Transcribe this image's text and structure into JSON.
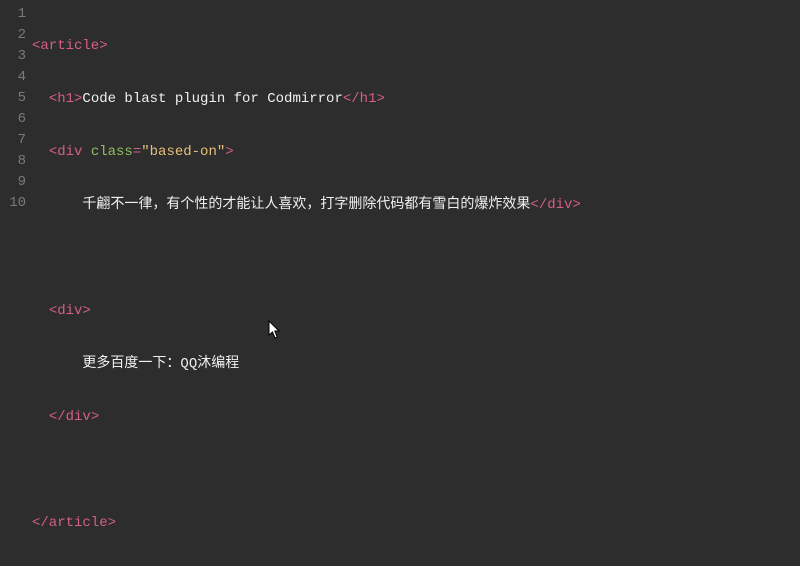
{
  "editor": {
    "gutter": [
      "1",
      "2",
      "3",
      "4",
      "5",
      "6",
      "7",
      "8",
      "9",
      "10"
    ],
    "lines": {
      "l1": {
        "open": "<article>"
      },
      "l2": {
        "ind": "  ",
        "open": "<h1>",
        "text": "Code blast plugin for Codmirror",
        "close": "</h1>"
      },
      "l3": {
        "ind": "  ",
        "open1": "<div",
        "space": " ",
        "attr": "class",
        "eq": "=",
        "val": "\"based-on\"",
        "open2": ">"
      },
      "l4": {
        "ind": "      ",
        "text": "千翩不一律，有个性的才能让人喜欢，打字删除代码都有雪白的爆炸效果",
        "close": "</div>"
      },
      "l5": {
        "ind": ""
      },
      "l6": {
        "ind": "  ",
        "open": "<div>"
      },
      "l7": {
        "ind": "      ",
        "text": "更多百度一下：QQ沐编程"
      },
      "l8": {
        "ind": "  ",
        "close": "</div>"
      },
      "l9": {
        "ind": ""
      },
      "l10": {
        "close": "</article>"
      }
    }
  },
  "colors": {
    "background": "#2d2d2d",
    "tag": "#d65f83",
    "attr": "#8fbf60",
    "string": "#e6c07b",
    "text": "#f0f0f0",
    "lineno": "#7a7a7a"
  }
}
